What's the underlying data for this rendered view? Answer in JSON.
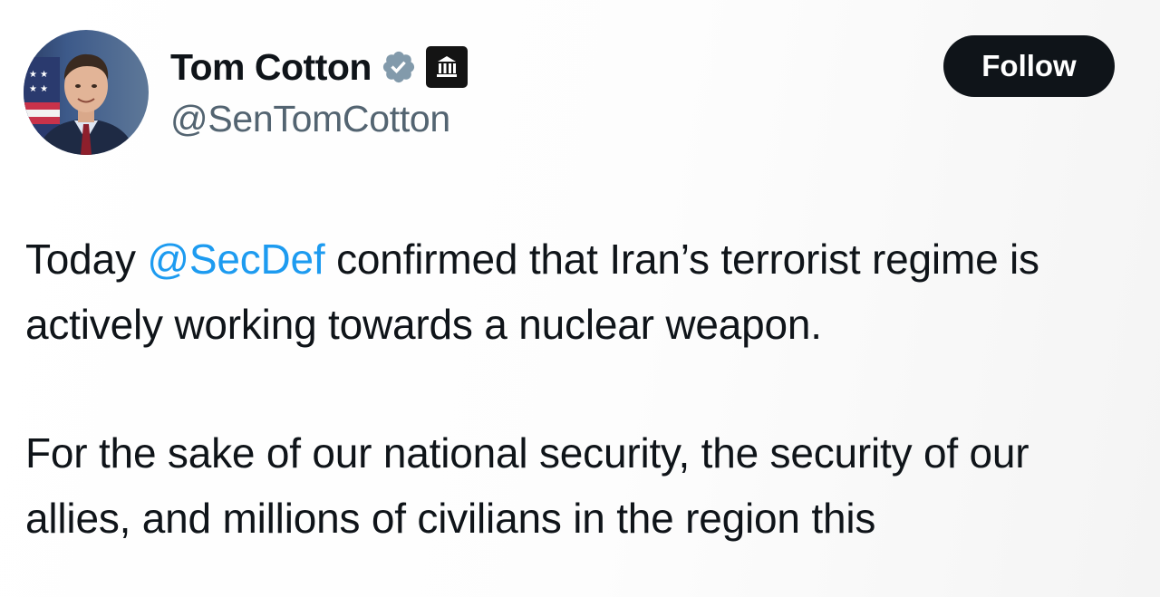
{
  "author": {
    "display_name": "Tom Cotton",
    "handle": "@SenTomCotton",
    "verified_icon": "gray-verified-check-icon",
    "affiliate_badge_icon": "government-building-icon",
    "avatar": "profile-photo"
  },
  "follow_button": {
    "label": "Follow"
  },
  "tweet": {
    "paragraph1": {
      "before": "Today ",
      "mention": "@SecDef",
      "after": " confirmed that Iran’s terrorist regime is actively working towards a nuclear weapon."
    },
    "paragraph2": "For the sake of our national security, the security of our allies, and millions of civilians in the region this"
  },
  "colors": {
    "text": "#0f1419",
    "secondary_text": "#536471",
    "mention": "#1d9bf0",
    "follow_button_bg": "#0f1419",
    "verified_badge": "#829aab"
  }
}
